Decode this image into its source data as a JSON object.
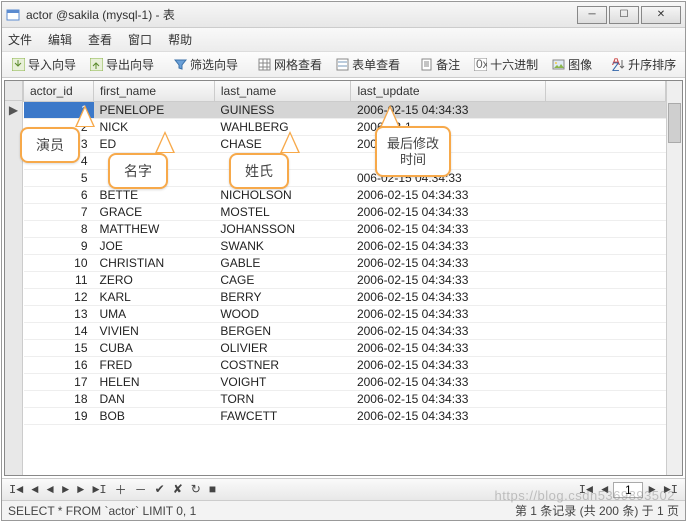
{
  "window": {
    "title": "actor @sakila (mysql-1) - 表"
  },
  "menu": {
    "file": "文件",
    "edit": "编辑",
    "view": "查看",
    "window": "窗口",
    "help": "帮助"
  },
  "toolbar": {
    "import": "导入向导",
    "export": "导出向导",
    "filter": "筛选向导",
    "grid": "网格查看",
    "form": "表单查看",
    "memo": "备注",
    "hex": "十六进制",
    "image": "图像",
    "sort": "升序排序"
  },
  "columns": {
    "actor_id": "actor_id",
    "first_name": "first_name",
    "last_name": "last_name",
    "last_update": "last_update"
  },
  "rows": [
    {
      "id": "1",
      "fn": "PENELOPE",
      "ln": "GUINESS",
      "ts": "2006-02-15 04:34:33"
    },
    {
      "id": "2",
      "fn": "NICK",
      "ln": "WAHLBERG",
      "ts": "2006-02-1"
    },
    {
      "id": "3",
      "fn": "ED",
      "ln": "CHASE",
      "ts": "2006-02-"
    },
    {
      "id": "4",
      "fn": "",
      "ln": "",
      "ts": ""
    },
    {
      "id": "5",
      "fn": "",
      "ln": "",
      "ts": "006-02-15 04:34:33"
    },
    {
      "id": "6",
      "fn": "BETTE",
      "ln": "NICHOLSON",
      "ts": "2006-02-15 04:34:33"
    },
    {
      "id": "7",
      "fn": "GRACE",
      "ln": "MOSTEL",
      "ts": "2006-02-15 04:34:33"
    },
    {
      "id": "8",
      "fn": "MATTHEW",
      "ln": "JOHANSSON",
      "ts": "2006-02-15 04:34:33"
    },
    {
      "id": "9",
      "fn": "JOE",
      "ln": "SWANK",
      "ts": "2006-02-15 04:34:33"
    },
    {
      "id": "10",
      "fn": "CHRISTIAN",
      "ln": "GABLE",
      "ts": "2006-02-15 04:34:33"
    },
    {
      "id": "11",
      "fn": "ZERO",
      "ln": "CAGE",
      "ts": "2006-02-15 04:34:33"
    },
    {
      "id": "12",
      "fn": "KARL",
      "ln": "BERRY",
      "ts": "2006-02-15 04:34:33"
    },
    {
      "id": "13",
      "fn": "UMA",
      "ln": "WOOD",
      "ts": "2006-02-15 04:34:33"
    },
    {
      "id": "14",
      "fn": "VIVIEN",
      "ln": "BERGEN",
      "ts": "2006-02-15 04:34:33"
    },
    {
      "id": "15",
      "fn": "CUBA",
      "ln": "OLIVIER",
      "ts": "2006-02-15 04:34:33"
    },
    {
      "id": "16",
      "fn": "FRED",
      "ln": "COSTNER",
      "ts": "2006-02-15 04:34:33"
    },
    {
      "id": "17",
      "fn": "HELEN",
      "ln": "VOIGHT",
      "ts": "2006-02-15 04:34:33"
    },
    {
      "id": "18",
      "fn": "DAN",
      "ln": "TORN",
      "ts": "2006-02-15 04:34:33"
    },
    {
      "id": "19",
      "fn": "BOB",
      "ln": "FAWCETT",
      "ts": "2006-02-15 04:34:33"
    }
  ],
  "nav": {
    "page": "1"
  },
  "status": {
    "sql": "SELECT * FROM `actor` LIMIT 0, 1",
    "info": "第 1 条记录 (共 200 条) 于 1 页"
  },
  "callouts": {
    "actor": "演员",
    "first": "名字",
    "last": "姓氏",
    "update": "最后修改\n时间"
  },
  "watermark": "https://blog.csdn5369893502"
}
